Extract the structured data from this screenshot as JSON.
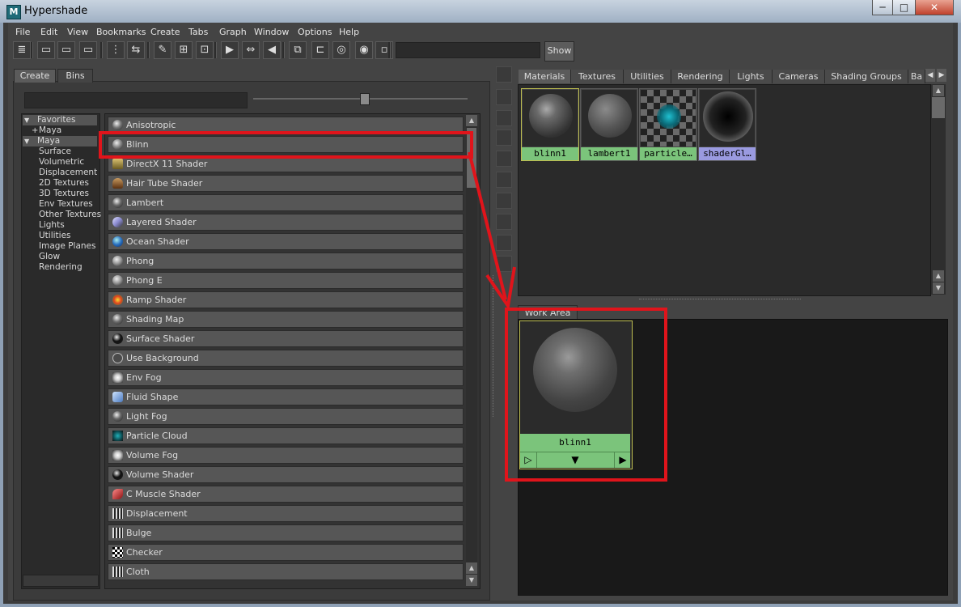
{
  "window": {
    "title": "Hypershade",
    "app_icon": "M",
    "controls": [
      "─",
      "□",
      "✕"
    ]
  },
  "menu": [
    "File",
    "Edit",
    "View",
    "Bookmarks",
    "Create",
    "Tabs",
    "Graph",
    "Window",
    "Options",
    "Help"
  ],
  "toolbar": {
    "show_label": "Show",
    "field_value": ""
  },
  "left_tabs": [
    "Create",
    "Bins"
  ],
  "tree": [
    {
      "label": "Favorites",
      "type": "header",
      "expander": "▼"
    },
    {
      "label": "Maya",
      "type": "sub",
      "expander": "+"
    },
    {
      "label": "Maya",
      "type": "header",
      "expander": "▼"
    },
    {
      "label": "Surface",
      "type": "child"
    },
    {
      "label": "Volumetric",
      "type": "child"
    },
    {
      "label": "Displacement",
      "type": "child"
    },
    {
      "label": "2D Textures",
      "type": "child"
    },
    {
      "label": "3D Textures",
      "type": "child"
    },
    {
      "label": "Env Textures",
      "type": "child"
    },
    {
      "label": "Other Textures",
      "type": "child"
    },
    {
      "label": "Lights",
      "type": "child"
    },
    {
      "label": "Utilities",
      "type": "child"
    },
    {
      "label": "Image Planes",
      "type": "child"
    },
    {
      "label": "Glow",
      "type": "child"
    },
    {
      "label": "Rendering",
      "type": "child"
    }
  ],
  "create_list": [
    {
      "label": "Anisotropic",
      "icon": "sphere-icon",
      "color": "#777777"
    },
    {
      "label": "Blinn",
      "icon": "sphere-icon",
      "color": "#888888"
    },
    {
      "label": "DirectX 11 Shader",
      "icon": "directx-icon",
      "color": "#b8a060"
    },
    {
      "label": "Hair Tube Shader",
      "icon": "hair-icon",
      "color": "#8a5a30"
    },
    {
      "label": "Lambert",
      "icon": "sphere-icon",
      "color": "#6a6a6a"
    },
    {
      "label": "Layered Shader",
      "icon": "layered-icon",
      "color": "#9090c0"
    },
    {
      "label": "Ocean Shader",
      "icon": "ocean-icon",
      "color": "#3a7ad0"
    },
    {
      "label": "Phong",
      "icon": "sphere-icon",
      "color": "#999999"
    },
    {
      "label": "Phong E",
      "icon": "sphere-icon",
      "color": "#999999"
    },
    {
      "label": "Ramp Shader",
      "icon": "ramp-icon",
      "color": "#d06020"
    },
    {
      "label": "Shading Map",
      "icon": "sphere-icon",
      "color": "#6e6e6e"
    },
    {
      "label": "Surface Shader",
      "icon": "sphere-icon",
      "color": "#111111"
    },
    {
      "label": "Use Background",
      "icon": "sphere-icon",
      "color": "#555555"
    },
    {
      "label": "Env Fog",
      "icon": "envfog-icon",
      "color": "#dddddd"
    },
    {
      "label": "Fluid Shape",
      "icon": "fluid-icon",
      "color": "#8ab0e0"
    },
    {
      "label": "Light Fog",
      "icon": "lightfog-icon",
      "color": "#666666"
    },
    {
      "label": "Particle Cloud",
      "icon": "particle-icon",
      "color": "#1a8a90"
    },
    {
      "label": "Volume Fog",
      "icon": "volfog-icon",
      "color": "#eeeeee"
    },
    {
      "label": "Volume Shader",
      "icon": "sphere-icon",
      "color": "#111111"
    },
    {
      "label": "C Muscle Shader",
      "icon": "muscle-icon",
      "color": "#b03030"
    },
    {
      "label": "Displacement",
      "icon": "displacement-icon",
      "color": "#cccccc"
    },
    {
      "label": "Bulge",
      "icon": "bulge-icon",
      "color": "#999999"
    },
    {
      "label": "Checker",
      "icon": "checker-icon",
      "color": "#ffffff"
    },
    {
      "label": "Cloth",
      "icon": "cloth-icon",
      "color": "#bbbbbb"
    }
  ],
  "right_tabs": [
    "Materials",
    "Textures",
    "Utilities",
    "Rendering",
    "Lights",
    "Cameras",
    "Shading Groups",
    "Ba"
  ],
  "materials": [
    {
      "name": "blinn1",
      "type": "blinn",
      "label_color": "#7bc47b",
      "border_color": "#bdbd50"
    },
    {
      "name": "lambert1",
      "type": "lambert",
      "label_color": "#7bc47b",
      "border_color": "#5a5a5a"
    },
    {
      "name": "particle…",
      "type": "particle",
      "label_color": "#7bc47b",
      "border_color": "#5a5a5a"
    },
    {
      "name": "shaderGl…",
      "type": "shaderglow",
      "label_color": "#9a9ae0",
      "border_color": "#5a5a5a"
    }
  ],
  "work_area": {
    "tab": "Work Area",
    "node": {
      "name": "blinn1",
      "buttons": [
        "▷",
        "▼",
        "▶"
      ]
    }
  },
  "annotation_color": "#e0141b"
}
